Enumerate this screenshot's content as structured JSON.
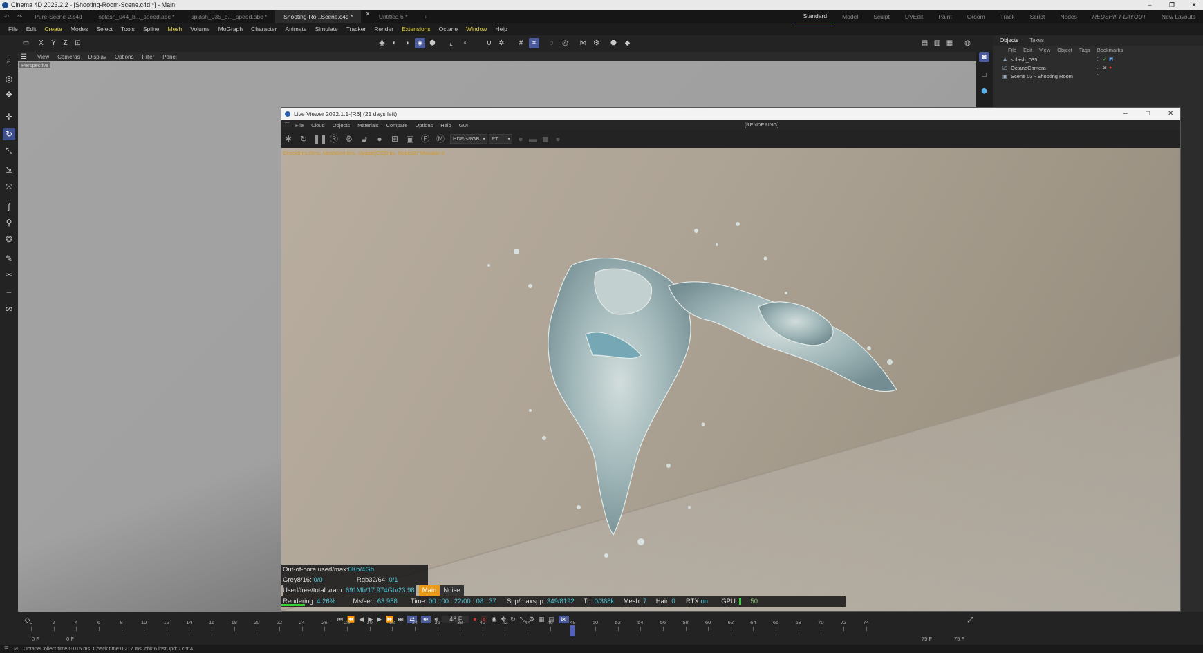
{
  "app": {
    "title": "Cinema 4D 2023.2.2 - [Shooting-Room-Scene.c4d *] - Main"
  },
  "doc_tabs": [
    {
      "label": "Pure-Scene-2.c4d",
      "active": false
    },
    {
      "label": "splash_044_b..._speed.abc *",
      "active": false
    },
    {
      "label": "splash_035_b..._speed.abc *",
      "active": false
    },
    {
      "label": "Shooting-Ro...Scene.c4d *",
      "active": true
    },
    {
      "label": "Untitled 6 *",
      "active": false
    }
  ],
  "layout_tabs": [
    {
      "label": "Standard",
      "active": true
    },
    {
      "label": "Model"
    },
    {
      "label": "Sculpt"
    },
    {
      "label": "UVEdit"
    },
    {
      "label": "Paint"
    },
    {
      "label": "Groom"
    },
    {
      "label": "Track"
    },
    {
      "label": "Script"
    },
    {
      "label": "Nodes"
    },
    {
      "label": "REDSHIFT-LAYOUT",
      "italic": true
    },
    {
      "label": "New Layouts"
    }
  ],
  "menus": [
    "File",
    "Edit",
    "Create",
    "Modes",
    "Select",
    "Tools",
    "Spline",
    "Mesh",
    "Volume",
    "MoGraph",
    "Character",
    "Animate",
    "Simulate",
    "Tracker",
    "Render",
    "Extensions",
    "Octane",
    "Window",
    "Help"
  ],
  "menu_highlight": [
    "Create",
    "Mesh",
    "Extensions",
    "Window"
  ],
  "axis_labels": [
    "X",
    "Y",
    "Z"
  ],
  "viewport": {
    "menu": [
      "View",
      "Cameras",
      "Display",
      "Options",
      "Filter",
      "Panel"
    ],
    "label": "Perspective"
  },
  "objects_panel": {
    "tabs": [
      "Objects",
      "Takes"
    ],
    "menu": [
      "File",
      "Edit",
      "View",
      "Object",
      "Tags",
      "Bookmarks"
    ],
    "rows": [
      {
        "name": "splash_035",
        "icon": "figure-icon"
      },
      {
        "name": "OctaneCamera",
        "icon": "camera-icon"
      },
      {
        "name": "Scene 03 - Shooting Room",
        "icon": "scene-icon"
      }
    ]
  },
  "live_viewer": {
    "title": "Live Viewer 2022.1.1-[R6] (21 days left)",
    "menu": [
      "File",
      "Cloud",
      "Objects",
      "Materials",
      "Compare",
      "Options",
      "Help",
      "GUI"
    ],
    "status": "[RENDERING]",
    "color_mode": "HDR/sRGB",
    "kernel": "PT",
    "debug": "Check0ms./0ms. MeshGen0ms. Update[CG]0ms. Nodes27 Movable:4",
    "hud": {
      "ooc_label": "Out-of-core used/max:",
      "ooc_value": "0Kb/4Gb",
      "grey_label": "Grey8/16:",
      "grey_value": "0/0",
      "rgb_label": "Rgb32/64:",
      "rgb_value": "0/1",
      "vram_label": "Used/free/total vram:",
      "vram_value": "691Mb/17.974Gb/23.98",
      "tag_main": "Main",
      "tag_noise": "Noise",
      "rendering_label": "Rendering:",
      "rendering_value": "4.26%",
      "mssec_label": "Ms/sec:",
      "mssec_value": "63.958",
      "time_label": "Time:",
      "time_value": "00 : 00 : 22/00 : 08 : 37",
      "spp_label": "Spp/maxspp:",
      "spp_value": "349/8192",
      "tri_label": "Tri:",
      "tri_value": "0/368k",
      "mesh_label": "Mesh:",
      "mesh_value": "7",
      "hair_label": "Hair:",
      "hair_value": "0",
      "rtx_label": "RTX:",
      "rtx_value": "on",
      "gpu_label": "GPU:",
      "gpu_value": "50",
      "progress": 0.0426
    }
  },
  "timeline": {
    "ticks": [
      0,
      2,
      4,
      6,
      8,
      10,
      12,
      14,
      16,
      18,
      20,
      22,
      24,
      26,
      28,
      30,
      32,
      34,
      36,
      38,
      40,
      42,
      44,
      46,
      48,
      50,
      52,
      54,
      56,
      58,
      60,
      62,
      64,
      66,
      68,
      70,
      72,
      74
    ],
    "current_frame": 48,
    "current_frame_label": "48 F",
    "start": "0 F",
    "start2": "0 F",
    "end": "75 F",
    "end2": "75 F"
  },
  "status": "OctaneCollect time:0.015 ms.  Check time:0.217 ms.  chk:6  instUpd:0  cnt:4"
}
